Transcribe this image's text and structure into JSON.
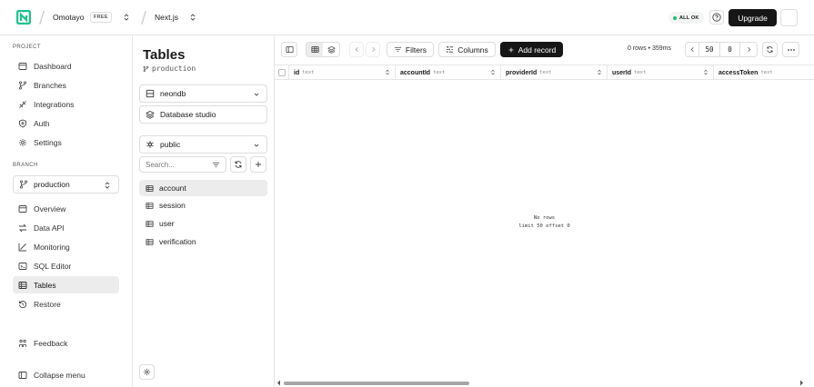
{
  "topbar": {
    "org_name": "Omotayo",
    "org_plan": "FREE",
    "project_name": "Next.js",
    "status": "ALL OK",
    "upgrade_label": "Upgrade",
    "status_color": "#1fbf73"
  },
  "sidebar": {
    "project_label": "PROJECT",
    "project_items": [
      {
        "label": "Dashboard",
        "icon": "dashboard-icon"
      },
      {
        "label": "Branches",
        "icon": "branch-icon"
      },
      {
        "label": "Integrations",
        "icon": "integrations-icon"
      },
      {
        "label": "Auth",
        "icon": "auth-icon"
      },
      {
        "label": "Settings",
        "icon": "gear-icon"
      }
    ],
    "branch_label": "BRANCH",
    "branch_selected": "production",
    "branch_items": [
      {
        "label": "Overview",
        "icon": "overview-icon"
      },
      {
        "label": "Data API",
        "icon": "data-api-icon"
      },
      {
        "label": "Monitoring",
        "icon": "monitoring-icon"
      },
      {
        "label": "SQL Editor",
        "icon": "sql-editor-icon"
      },
      {
        "label": "Tables",
        "icon": "table-icon",
        "active": true
      },
      {
        "label": "Restore",
        "icon": "restore-icon"
      }
    ],
    "feedback_label": "Feedback",
    "collapse_label": "Collapse menu"
  },
  "tables_panel": {
    "title": "Tables",
    "branch": "production",
    "database": "neondb",
    "studio_label": "Database studio",
    "schema": "public",
    "search_placeholder": "Search...",
    "tables": [
      "account",
      "session",
      "user",
      "verification"
    ],
    "active_table": "account"
  },
  "toolbar": {
    "filters_label": "Filters",
    "columns_label": "Columns",
    "add_record_label": "Add record",
    "row_info": "0 rows • 359ms",
    "limit": "50",
    "offset": "0"
  },
  "table": {
    "columns": [
      {
        "name": "id",
        "type": "text"
      },
      {
        "name": "accountId",
        "type": "text"
      },
      {
        "name": "providerId",
        "type": "text"
      },
      {
        "name": "userId",
        "type": "text"
      },
      {
        "name": "accessToken",
        "type": "text"
      }
    ],
    "empty_line1": "No rows",
    "empty_line2": "limit 50 offset 0"
  },
  "colors": {
    "brand_green": "#1ec28b",
    "dark_button": "#161616",
    "active_bg": "#ececec"
  }
}
